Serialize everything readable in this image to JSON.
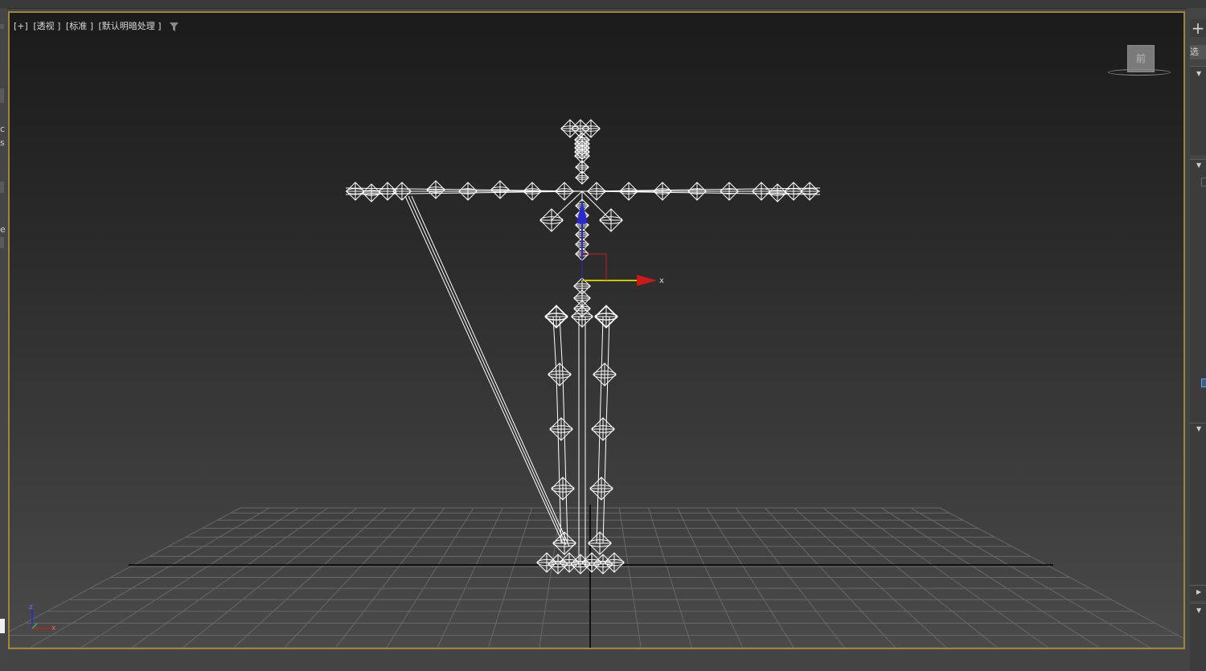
{
  "viewport": {
    "label_parts": [
      "[+]",
      "[透视 ]",
      "[标准 ]",
      "[默认明暗处理 ]"
    ],
    "viewcube_face": "前",
    "gizmo_axis_label": "x",
    "axis_tripod_labels": [
      "z",
      "x"
    ],
    "border_color": "#a0863a"
  },
  "left_strip": {
    "chars": [
      "c",
      "s",
      "e"
    ]
  },
  "right_panel": {
    "plus_label": "+",
    "select_label": "选"
  },
  "icons": {
    "filter": "filter-icon",
    "viewcube": "viewcube-icon",
    "transform_gizmo": "move-gizmo-icon",
    "axis_tripod": "axis-tripod-icon"
  },
  "colors": {
    "x_axis": "#cc1a1a",
    "y_axis": "#c8c800",
    "z_axis": "#2a2ad0",
    "wireframe": "#ffffff"
  }
}
